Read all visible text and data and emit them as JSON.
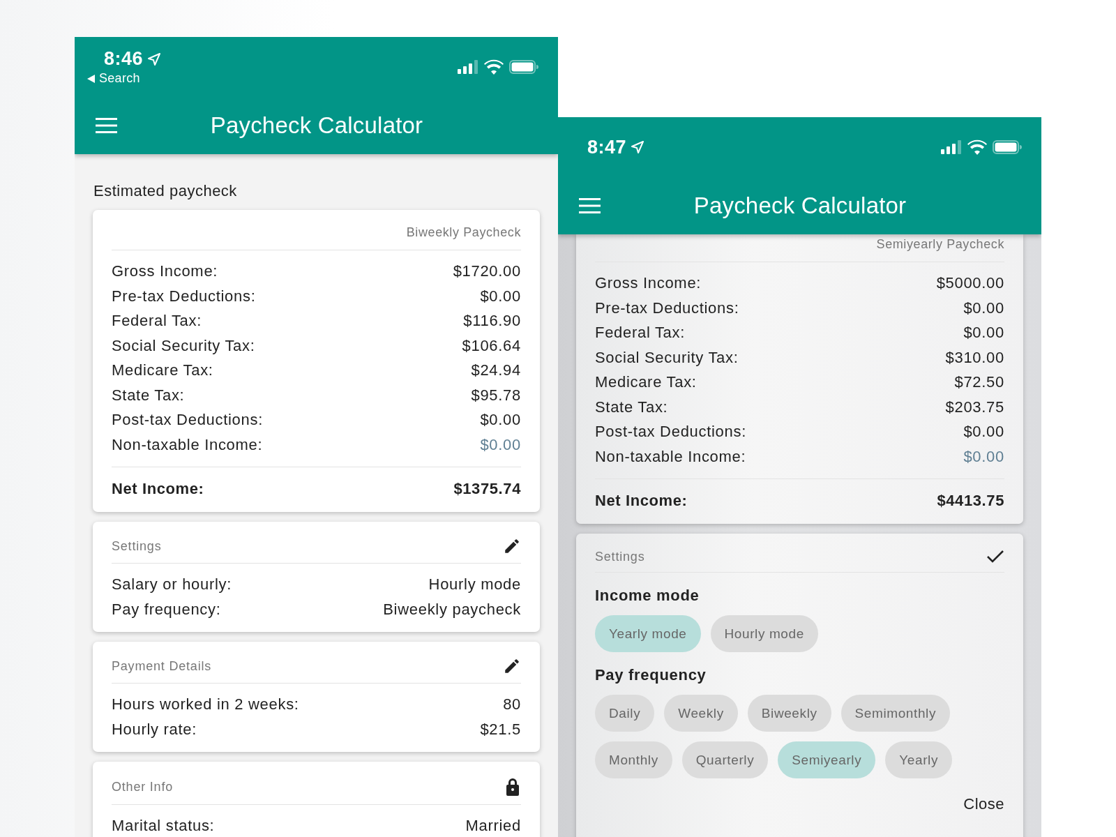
{
  "screens": [
    {
      "dimmed": false,
      "status_bar": {
        "time": "8:46",
        "back_label": "Search"
      },
      "app_bar": {
        "title": "Paycheck Calculator"
      },
      "section_title": "Estimated paycheck",
      "cards": [
        {
          "kind": "summary",
          "caption": "Biweekly Paycheck",
          "rows": [
            {
              "label": "Gross Income:",
              "value": "$1720.00",
              "kind": "line"
            },
            {
              "label": "Pre-tax Deductions:",
              "value": "$0.00",
              "kind": "line"
            },
            {
              "label": "Federal Tax:",
              "value": "$116.90",
              "kind": "line"
            },
            {
              "label": "Social Security Tax:",
              "value": "$106.64",
              "kind": "line"
            },
            {
              "label": "Medicare Tax:",
              "value": "$24.94",
              "kind": "line"
            },
            {
              "label": "State Tax:",
              "value": "$95.78",
              "kind": "line"
            },
            {
              "label": "Post-tax Deductions:",
              "value": "$0.00",
              "kind": "line"
            },
            {
              "label": "Non-taxable Income:",
              "value": "$0.00",
              "kind": "income"
            }
          ],
          "total": {
            "label": "Net Income:",
            "value": "$1375.74"
          }
        },
        {
          "kind": "info",
          "title": "Settings",
          "action": {
            "kind": "edit"
          },
          "rows": [
            {
              "label": "Salary or hourly:",
              "value": "Hourly mode"
            },
            {
              "label": "Pay frequency:",
              "value": "Biweekly paycheck"
            }
          ]
        },
        {
          "kind": "info",
          "title": "Payment Details",
          "action": {
            "kind": "edit"
          },
          "rows": [
            {
              "label": "Hours worked in 2 weeks:",
              "value": "80"
            },
            {
              "label": "Hourly rate:",
              "value": "$21.5"
            }
          ]
        },
        {
          "kind": "info",
          "title": "Other Info",
          "action": {
            "kind": "locked"
          },
          "rows": [
            {
              "label": "Marital status:",
              "value": "Married"
            }
          ]
        }
      ]
    },
    {
      "dimmed": true,
      "status_bar": {
        "time": "8:47"
      },
      "app_bar": {
        "title": "Paycheck Calculator"
      },
      "cards": [
        {
          "kind": "summary",
          "caption": "Semiyearly Paycheck",
          "rows": [
            {
              "label": "Gross Income:",
              "value": "$5000.00",
              "kind": "line"
            },
            {
              "label": "Pre-tax Deductions:",
              "value": "$0.00",
              "kind": "line"
            },
            {
              "label": "Federal Tax:",
              "value": "$0.00",
              "kind": "line"
            },
            {
              "label": "Social Security Tax:",
              "value": "$310.00",
              "kind": "line"
            },
            {
              "label": "Medicare Tax:",
              "value": "$72.50",
              "kind": "line"
            },
            {
              "label": "State Tax:",
              "value": "$203.75",
              "kind": "line"
            },
            {
              "label": "Post-tax Deductions:",
              "value": "$0.00",
              "kind": "line"
            },
            {
              "label": "Non-taxable Income:",
              "value": "$0.00",
              "kind": "income"
            }
          ],
          "total": {
            "label": "Net Income:",
            "value": "$4413.75"
          }
        },
        {
          "kind": "editor",
          "title": "Settings",
          "action": {
            "kind": "done"
          },
          "groups": [
            {
              "title": "Income mode",
              "options": [
                {
                  "label": "Yearly mode",
                  "selected": true
                },
                {
                  "label": "Hourly mode",
                  "selected": false
                }
              ]
            },
            {
              "title": "Pay frequency",
              "options": [
                {
                  "label": "Daily",
                  "selected": false
                },
                {
                  "label": "Weekly",
                  "selected": false
                },
                {
                  "label": "Biweekly",
                  "selected": false
                },
                {
                  "label": "Semimonthly",
                  "selected": false
                },
                {
                  "label": "Monthly",
                  "selected": false
                },
                {
                  "label": "Quarterly",
                  "selected": false
                },
                {
                  "label": "Semiyearly",
                  "selected": true
                },
                {
                  "label": "Yearly",
                  "selected": false
                }
              ]
            }
          ],
          "close_label": "Close"
        }
      ]
    }
  ]
}
